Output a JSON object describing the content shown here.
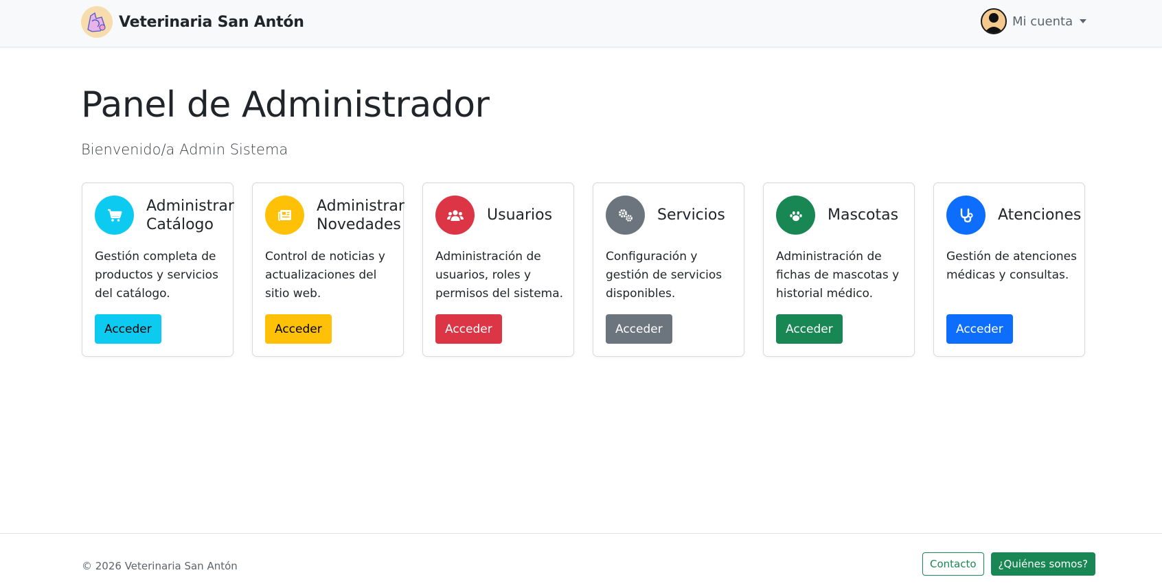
{
  "navbar": {
    "brand_name": "Veterinaria San Antón",
    "account_label": "Mi cuenta"
  },
  "header": {
    "title": "Panel de Administrador",
    "welcome": "Bienvenido/a Admin Sistema"
  },
  "cards": [
    {
      "title_line1": "Administrar",
      "title_line2": "Catálogo",
      "text": "Gestión completa de productos y servicios del catálogo.",
      "button": "Acceder",
      "icon": "shopping-cart-icon",
      "color": "#0dcaf0"
    },
    {
      "title_line1": "Administrar",
      "title_line2": "Novedades",
      "text": "Control de noticias y actualizaciones del sitio web.",
      "button": "Acceder",
      "icon": "newspaper-icon",
      "color": "#ffc107"
    },
    {
      "title_line1": "Usuarios",
      "title_line2": "",
      "text": "Administración de usuarios, roles y permisos del sistema.",
      "button": "Acceder",
      "icon": "users-icon",
      "color": "#dc3545"
    },
    {
      "title_line1": "Servicios",
      "title_line2": "",
      "text": "Configuración y gestión de servicios disponibles.",
      "button": "Acceder",
      "icon": "gears-icon",
      "color": "#6c757d"
    },
    {
      "title_line1": "Mascotas",
      "title_line2": "",
      "text": "Administración de fichas de mascotas y historial médico.",
      "button": "Acceder",
      "icon": "paw-icon",
      "color": "#198754"
    },
    {
      "title_line1": "Atenciones",
      "title_line2": "",
      "text": "Gestión de atenciones médicas y consultas.",
      "button": "Acceder",
      "icon": "stethoscope-icon",
      "color": "#0d6efd"
    }
  ],
  "footer": {
    "copyright": "© 2026 Veterinaria San Antón",
    "contact_label": "Contacto",
    "about_label": "¿Quiénes somos?"
  }
}
